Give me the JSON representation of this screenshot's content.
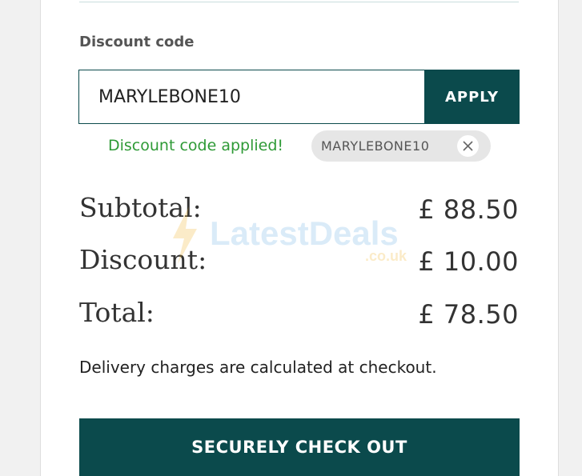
{
  "discount": {
    "label": "Discount code",
    "input_value": "MARYLEBONE10",
    "apply_label": "APPLY",
    "applied_message": "Discount code applied!",
    "applied_chip": "MARYLEBONE10",
    "chip_close_icon": "close-icon"
  },
  "summary": {
    "subtotal_label": "Subtotal:",
    "subtotal_value": "£ 88.50",
    "discount_label": "Discount:",
    "discount_value": "£ 10.00",
    "total_label": "Total:",
    "total_value": "£ 78.50"
  },
  "watermark": {
    "brand": "LatestDeals",
    "domain": ".co.uk"
  },
  "delivery_note": "Delivery charges are calculated at checkout.",
  "checkout_label": "SECURELY CHECK OUT",
  "colors": {
    "primary": "#0b4a4c",
    "success": "#2e9a36",
    "chip_bg": "#e6e6e6"
  }
}
